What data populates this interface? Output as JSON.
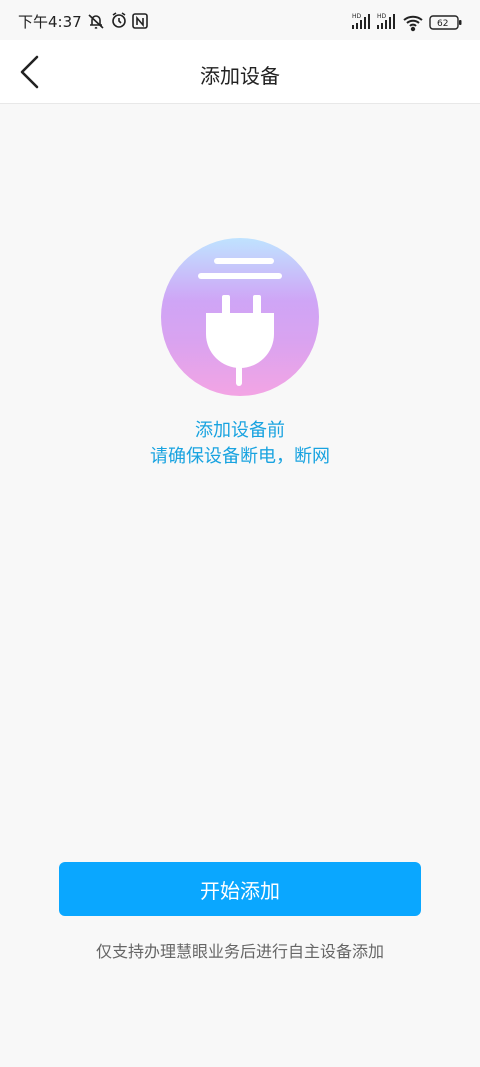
{
  "status_bar": {
    "time": "下午4:37",
    "battery": "62",
    "network_label_1": "HD",
    "network_label_2": "HD"
  },
  "header": {
    "title": "添加设备"
  },
  "main": {
    "hint_line1": "添加设备前",
    "hint_line2": "请确保设备断电，断网",
    "start_button_label": "开始添加",
    "footnote": "仅支持办理慧眼业务后进行自主设备添加"
  },
  "colors": {
    "accent": "#0aa7ff",
    "hint_text": "#19a3e0"
  },
  "icons": {
    "back": "chevron-left-icon",
    "hero": "power-plug-icon"
  }
}
